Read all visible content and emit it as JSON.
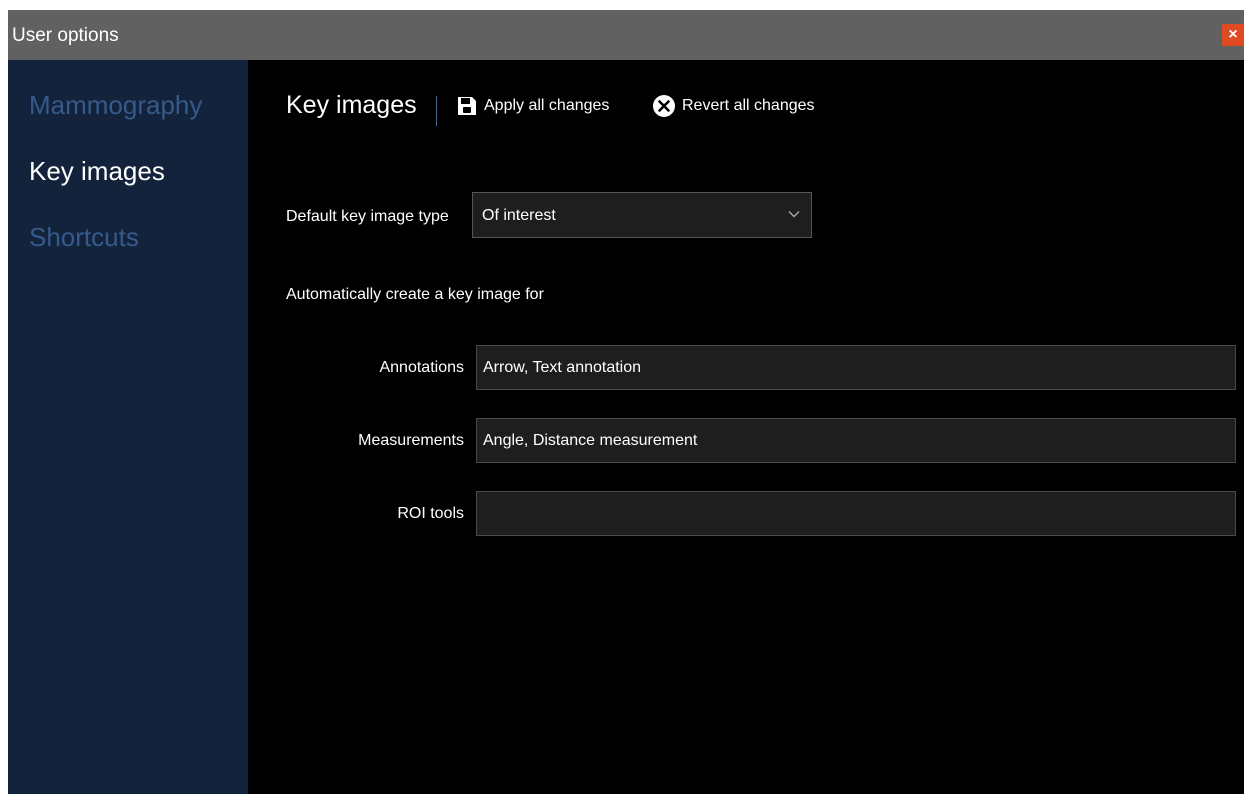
{
  "window": {
    "title": "User options",
    "close_label": "×"
  },
  "sidebar": {
    "items": [
      {
        "label": "Mammography",
        "active": false
      },
      {
        "label": "Key images",
        "active": true
      },
      {
        "label": "Shortcuts",
        "active": false
      }
    ]
  },
  "main": {
    "title": "Key images",
    "toolbar": {
      "apply_label": "Apply all changes",
      "apply_icon": "save-icon",
      "revert_label": "Revert all changes",
      "revert_icon": "close-circle-icon"
    },
    "default_type": {
      "label": "Default key image type",
      "value": "Of interest"
    },
    "auto_create_label": "Automatically create a key image for",
    "fields": [
      {
        "label": "Annotations",
        "value": "Arrow, Text annotation"
      },
      {
        "label": "Measurements",
        "value": "Angle, Distance measurement"
      },
      {
        "label": "ROI tools",
        "value": ""
      }
    ]
  },
  "colors": {
    "titlebar": "#616161",
    "sidebar": "#13233c",
    "inactive_nav": "#355a8b",
    "close_button": "#e04a22",
    "divider_accent": "#2f6fb5"
  }
}
